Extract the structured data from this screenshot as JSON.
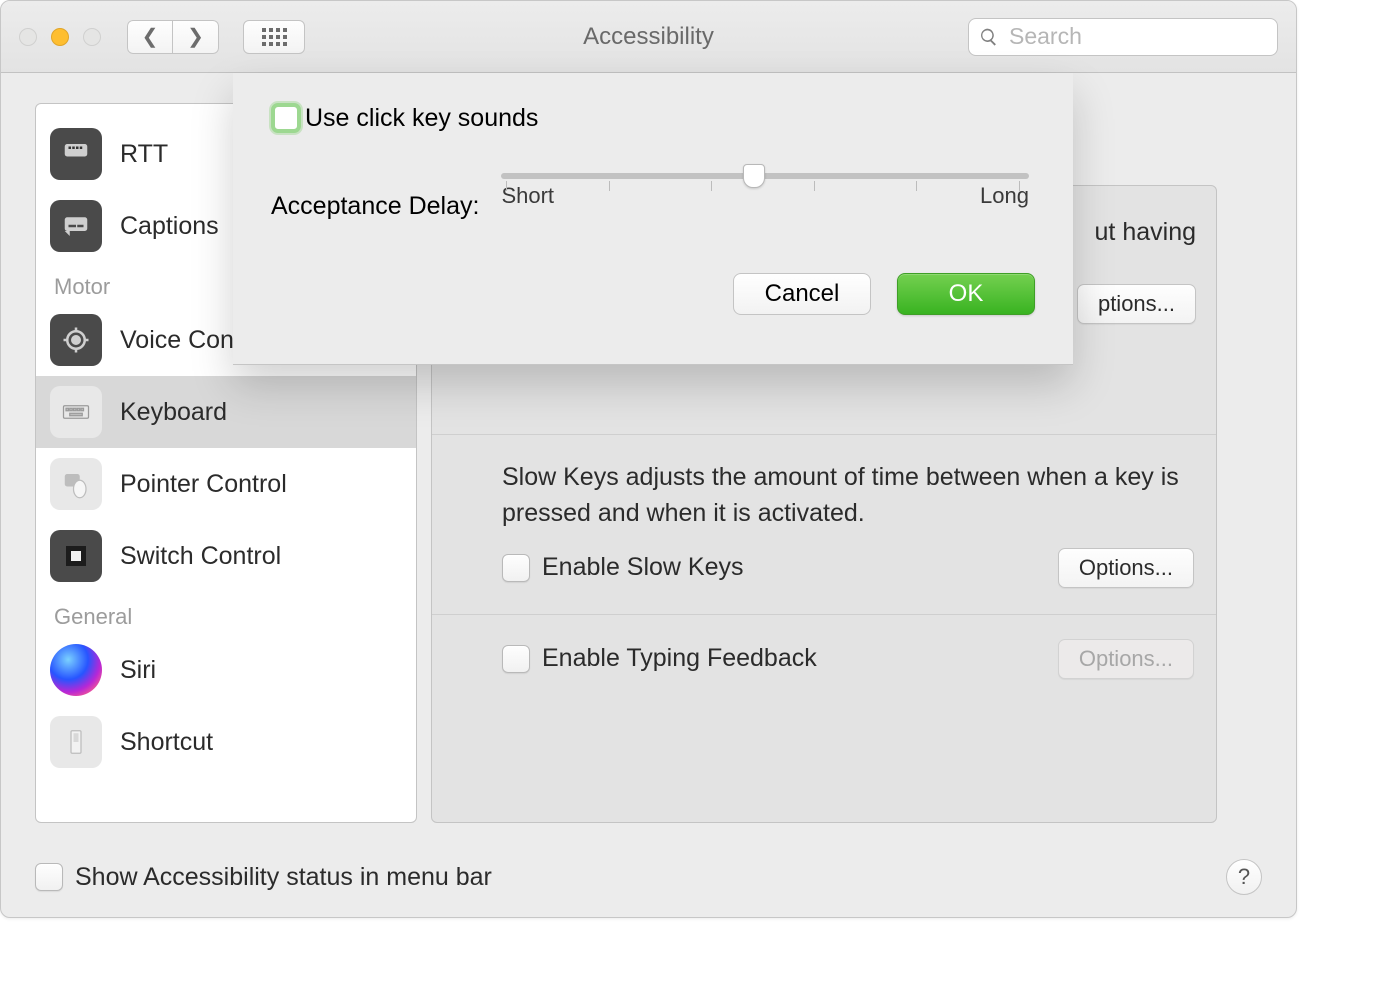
{
  "window": {
    "title": "Accessibility"
  },
  "toolbar": {
    "search_placeholder": "Search"
  },
  "sidebar": {
    "section_motor": "Motor",
    "section_general": "General",
    "items": {
      "rtt": "RTT",
      "captions": "Captions",
      "voice_control": "Voice Control",
      "keyboard": "Keyboard",
      "pointer_control": "Pointer Control",
      "switch_control": "Switch Control",
      "siri": "Siri",
      "shortcut": "Shortcut"
    }
  },
  "main": {
    "partial_desc": "ut having",
    "options_partial": "ptions...",
    "slow_keys_desc": "Slow Keys adjusts the amount of time between when a key is pressed and when it is activated.",
    "enable_slow_keys": "Enable Slow Keys",
    "options": "Options...",
    "enable_typing_feedback": "Enable Typing Feedback"
  },
  "sheet": {
    "use_click_key_sounds": "Use click key sounds",
    "acceptance_delay_label": "Acceptance Delay:",
    "short": "Short",
    "long": "Long",
    "cancel": "Cancel",
    "ok": "OK",
    "slider_value_percent": 48
  },
  "footer": {
    "show_status": "Show Accessibility status in menu bar",
    "help": "?"
  }
}
